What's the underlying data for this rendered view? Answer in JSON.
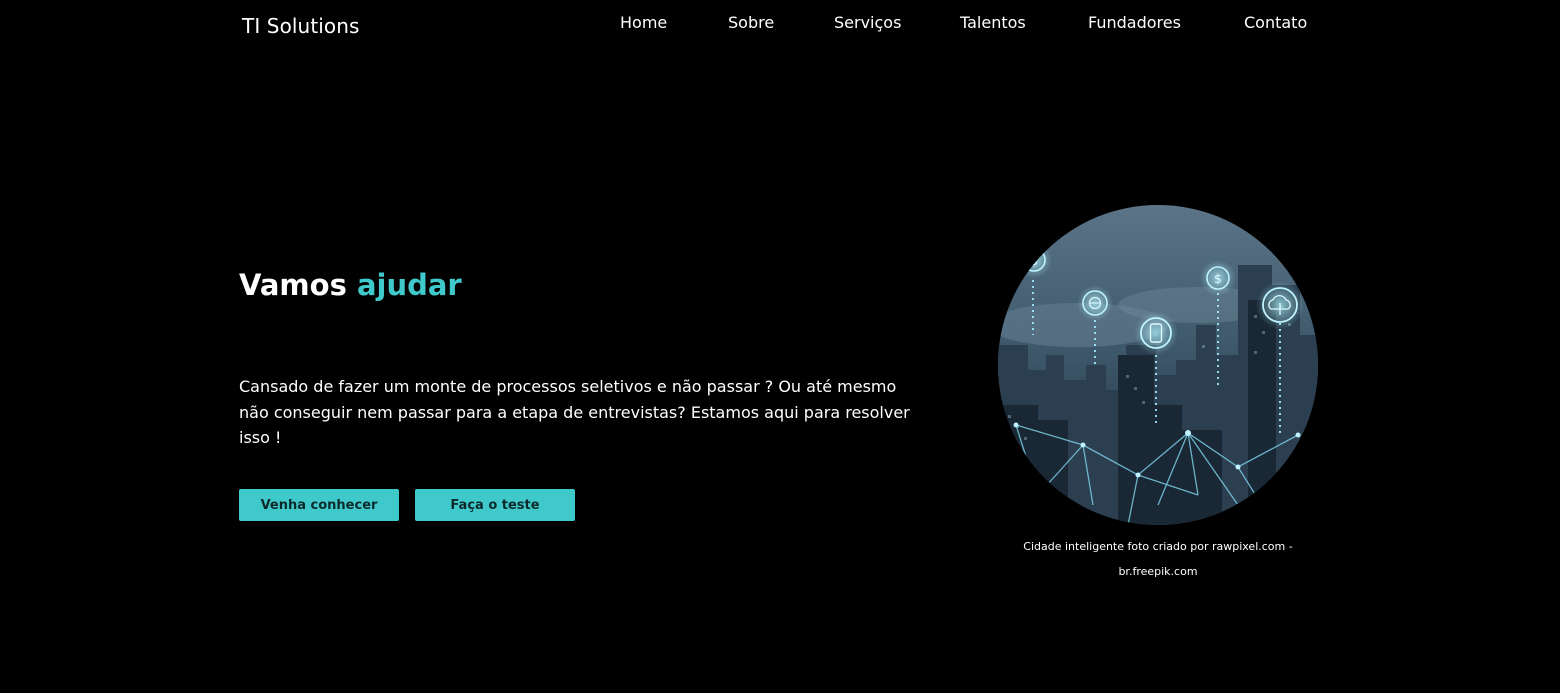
{
  "header": {
    "logo": "TI Solutions",
    "nav": [
      {
        "label": "Home"
      },
      {
        "label": "Sobre"
      },
      {
        "label": "Serviços"
      },
      {
        "label": "Talentos"
      },
      {
        "label": "Fundadores"
      },
      {
        "label": "Contato"
      }
    ]
  },
  "hero": {
    "title_main": "Vamos",
    "title_accent": "ajudar",
    "text": "Cansado de fazer um monte de processos seletivos e não passar ? Ou até mesmo não conseguir nem passar para a etapa de entrevistas? Estamos aqui para resolver isso !",
    "buttons": [
      {
        "label": "Venha conhecer"
      },
      {
        "label": "Faça o teste"
      }
    ]
  },
  "image": {
    "caption": "Cidade inteligente foto criado por rawpixel.com - br.freepik.com",
    "icons": [
      "dollar-icon",
      "globe-icon",
      "smartphone-icon",
      "dollar-icon",
      "cloud-upload-icon"
    ]
  },
  "colors": {
    "background": "#000000",
    "text": "#ffffff",
    "accent": "#40c9cb",
    "button_text": "#0c2a2b"
  }
}
